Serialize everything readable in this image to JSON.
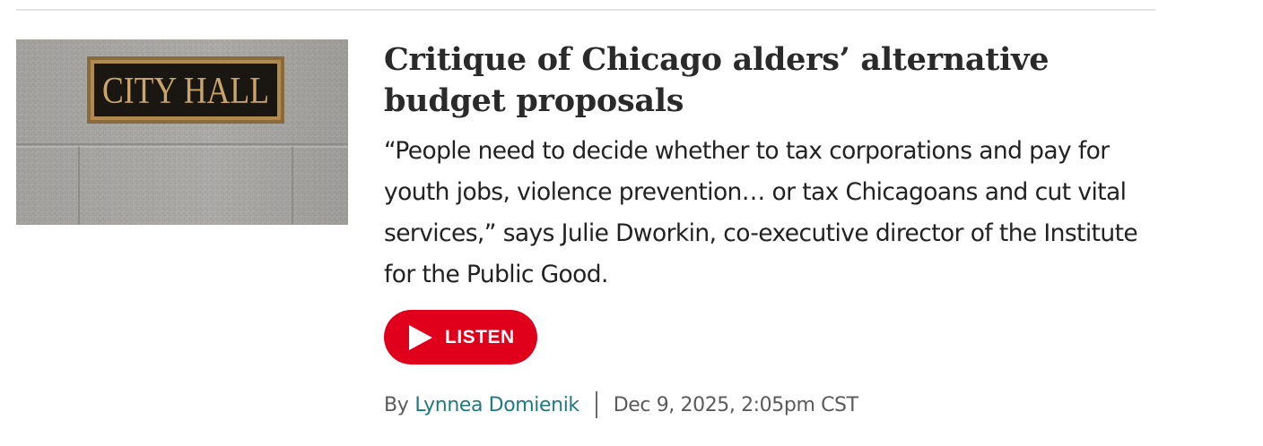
{
  "article": {
    "image_sign_text": "CITY HALL",
    "headline": "Critique of Chicago alders’ alternative budget proposals",
    "dek": "“People need to decide whether to tax corporations and pay for youth jobs, violence prevention… or tax Chicagoans and cut vital services,” says Julie Dworkin, co-executive director of the Institute for the Public Good.",
    "listen_label": "LISTEN",
    "byline_prefix": "By",
    "author": "Lynnea Domienik",
    "date": "Dec 9, 2025, 2:05pm CST"
  },
  "colors": {
    "listen_button": "#e0001b",
    "author_link": "#1f7a80",
    "headline": "#2a2a2a",
    "rule": "#e3e3e3"
  },
  "icons": {
    "listen": "play-icon"
  }
}
